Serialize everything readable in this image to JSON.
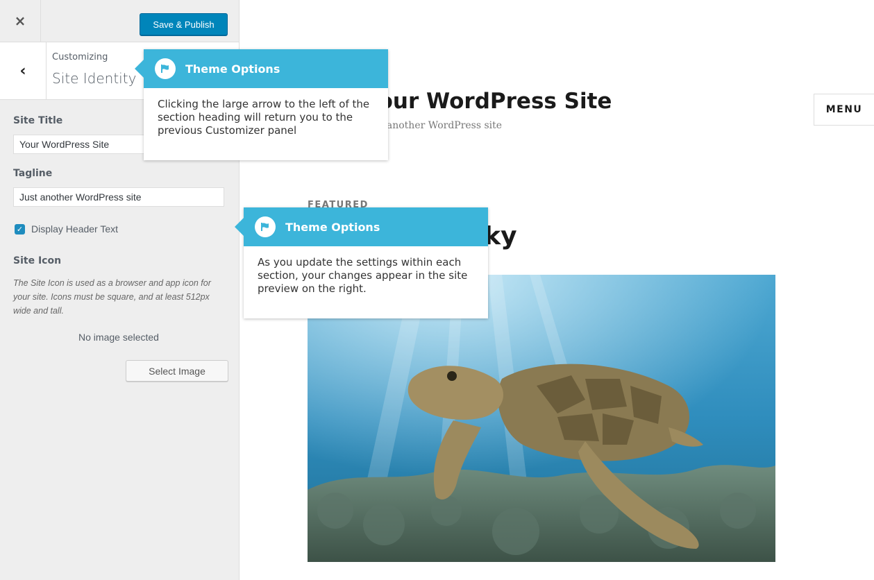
{
  "topbar": {
    "close_label": "×",
    "save_label": "Save & Publish"
  },
  "section": {
    "back_label": "‹",
    "customizing": "Customizing",
    "title": "Site Identity"
  },
  "fields": {
    "site_title_label": "Site Title",
    "site_title_value": "Your WordPress Site",
    "tagline_label": "Tagline",
    "tagline_value": "Just another WordPress site",
    "display_header_text": "Display Header Text",
    "display_header_checked": true,
    "site_icon_label": "Site Icon",
    "site_icon_description": "The Site Icon is used as a browser and app icon for your site. Icons must be square, and at least 512px wide and tall.",
    "no_image": "No image selected",
    "select_image": "Select Image"
  },
  "preview": {
    "site_title": "Your WordPress Site",
    "tagline": "Just another WordPress site",
    "menu": "MENU",
    "featured": "FEATURED",
    "post_title": "Stay Lucky"
  },
  "tooltips": [
    {
      "title": "Theme Options",
      "body": "Clicking the large arrow to the left of the section heading will return you to the previous Customizer panel"
    },
    {
      "title": "Theme Options",
      "body": "As you update the settings within each section, your changes appear in the site preview on the right."
    }
  ],
  "colors": {
    "accent": "#3cb5da",
    "primary_button": "#0085ba",
    "sidebar_bg": "#eeeeee"
  }
}
